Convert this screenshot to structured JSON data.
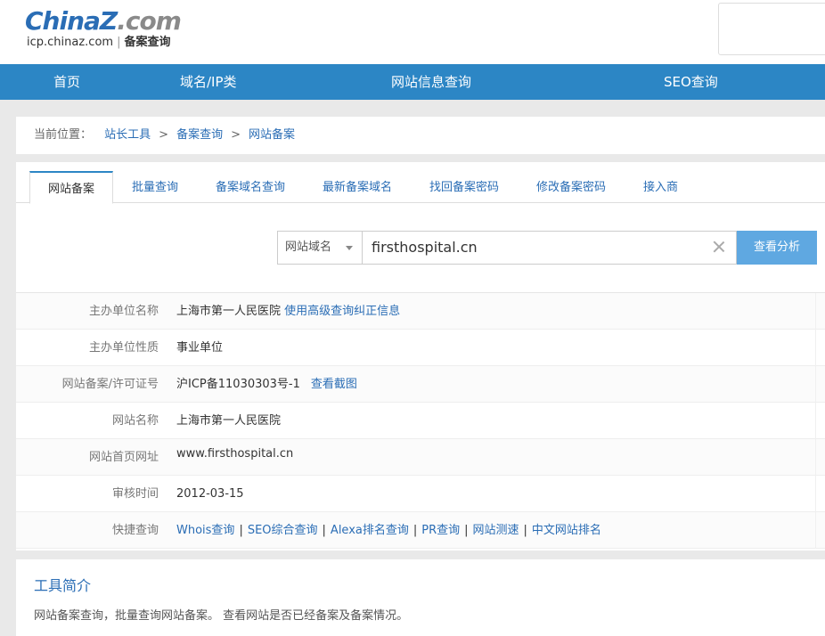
{
  "header": {
    "logo_left": "China",
    "logo_z": "Z",
    "logo_right": ".com",
    "sub_site": "icp.chinaz.com",
    "sub_sep": "|",
    "sub_name": "备案查询"
  },
  "nav": [
    "首页",
    "域名/IP类",
    "网站信息查询",
    "SEO查询"
  ],
  "breadcrumb": {
    "prefix": "当前位置：",
    "items": [
      "站长工具",
      "备案查询",
      "网站备案"
    ],
    "arrow": ">"
  },
  "tabs": [
    "网站备案",
    "批量查询",
    "备案域名查询",
    "最新备案域名",
    "找回备案密码",
    "修改备案密码",
    "接入商"
  ],
  "search": {
    "type_selected": "网站域名",
    "value": "firsthospital.cn",
    "button": "查看分析"
  },
  "results": {
    "rows": [
      {
        "label": "主办单位名称",
        "value": "上海市第一人民医院",
        "link": "使用高级查询纠正信息"
      },
      {
        "label": "主办单位性质",
        "value": "事业单位"
      },
      {
        "label": "网站备案/许可证号",
        "value": "沪ICP备11030303号-1",
        "link": "查看截图"
      },
      {
        "label": "网站名称",
        "value": "上海市第一人民医院"
      },
      {
        "label": "网站首页网址",
        "value": "www.firsthospital.cn"
      },
      {
        "label": "审核时间",
        "value": "2012-03-15"
      },
      {
        "label": "快捷查询",
        "links": [
          "Whois查询",
          "SEO综合查询",
          "Alexa排名查询",
          "PR查询",
          "网站测速",
          "中文网站排名"
        ],
        "separator": "|"
      }
    ]
  },
  "intro": {
    "title": "工具简介",
    "text": "网站备案查询，批量查询网站备案。 查看网站是否已经备案及备案情况。"
  },
  "colors": {
    "nav_bg": "#2c86c5",
    "link": "#2a6db5",
    "button_bg": "#5fa8e1",
    "page_bg": "#e9e9e9"
  }
}
